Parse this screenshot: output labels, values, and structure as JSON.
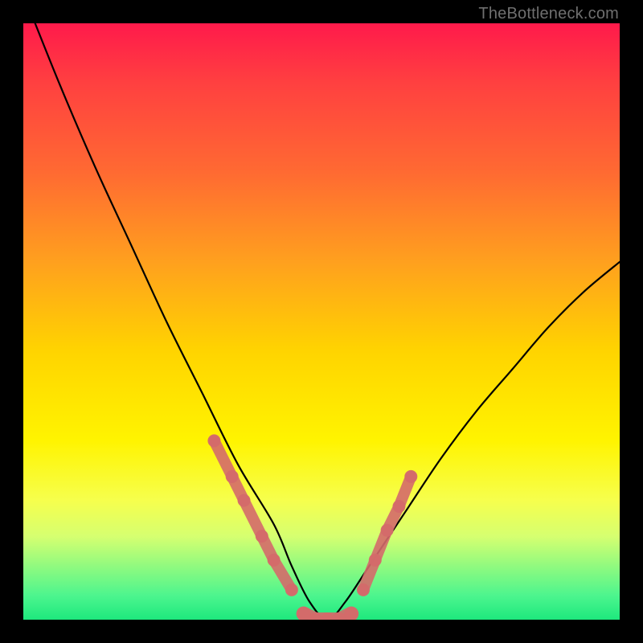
{
  "watermark": {
    "text": "TheBottleneck.com"
  },
  "chart_data": {
    "type": "line",
    "title": "",
    "xlabel": "",
    "ylabel": "",
    "xlim": [
      0,
      100
    ],
    "ylim": [
      0,
      100
    ],
    "grid": false,
    "legend": false,
    "series": [
      {
        "name": "curve",
        "x": [
          0,
          6,
          12,
          18,
          24,
          30,
          36,
          42,
          45,
          48,
          51,
          54,
          58,
          64,
          70,
          76,
          82,
          88,
          94,
          100
        ],
        "y": [
          105,
          90,
          76,
          63,
          50,
          38,
          26,
          16,
          9,
          3,
          0,
          3,
          9,
          18,
          27,
          35,
          42,
          49,
          55,
          60
        ]
      }
    ],
    "markers": [
      {
        "name": "left-dots",
        "color": "#d46a6a",
        "points": [
          {
            "x": 32,
            "y": 30
          },
          {
            "x": 35,
            "y": 24
          },
          {
            "x": 37,
            "y": 20
          },
          {
            "x": 40,
            "y": 14
          },
          {
            "x": 42,
            "y": 10
          },
          {
            "x": 45,
            "y": 5
          }
        ]
      },
      {
        "name": "trough-dots",
        "color": "#d46a6a",
        "points": [
          {
            "x": 47,
            "y": 1
          },
          {
            "x": 49,
            "y": 0
          },
          {
            "x": 51,
            "y": 0
          },
          {
            "x": 53,
            "y": 0
          },
          {
            "x": 55,
            "y": 1
          }
        ]
      },
      {
        "name": "right-dots",
        "color": "#d46a6a",
        "points": [
          {
            "x": 57,
            "y": 5
          },
          {
            "x": 59,
            "y": 10
          },
          {
            "x": 61,
            "y": 15
          },
          {
            "x": 63,
            "y": 19
          },
          {
            "x": 65,
            "y": 24
          }
        ]
      }
    ],
    "axis_labels": {
      "x_ticks": [],
      "y_ticks": []
    }
  }
}
